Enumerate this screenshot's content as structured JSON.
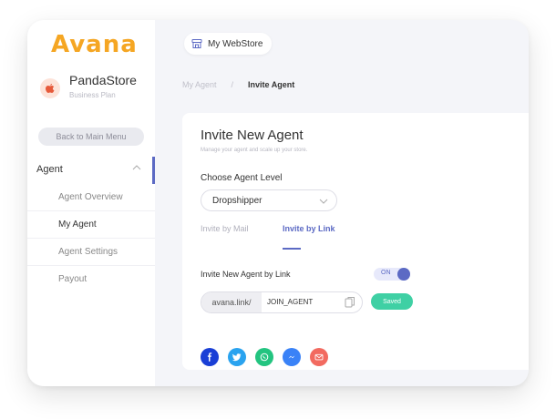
{
  "brand": {
    "logo": "Avana"
  },
  "store": {
    "avatar_icon": "apple-icon",
    "name": "PandaStore",
    "plan": "Business Plan"
  },
  "sidebar": {
    "back_label": "Back to Main Menu",
    "section": {
      "label": "Agent",
      "expanded": true
    },
    "items": [
      {
        "label": "Agent Overview",
        "active": false
      },
      {
        "label": "My Agent",
        "active": true
      },
      {
        "label": "Agent Settings",
        "active": false
      },
      {
        "label": "Payout",
        "active": false
      }
    ]
  },
  "topbar": {
    "store_button": "My WebStore",
    "store_icon": "store-icon"
  },
  "breadcrumb": {
    "parent": "My Agent",
    "separator": "/",
    "current": "Invite Agent"
  },
  "card": {
    "title": "Invite New Agent",
    "subtitle": "Manage your agent and scale up your store.",
    "level_label": "Choose Agent Level",
    "level_value": "Dropshipper",
    "tabs": [
      {
        "label": "Invite by Mail",
        "active": false
      },
      {
        "label": "Invite by Link",
        "active": true
      }
    ],
    "link_label": "Invite New Agent by Link",
    "toggle_label": "ON",
    "toggle_on": true,
    "link_prefix": "avana.link/",
    "link_value": "JOIN_AGENT",
    "saved_label": "Saved",
    "share": [
      {
        "name": "facebook-icon",
        "glyph": "f",
        "color": "#1a3fd6"
      },
      {
        "name": "twitter-icon",
        "glyph": "t",
        "color": "#2aa3ef"
      },
      {
        "name": "whatsapp-icon",
        "glyph": "w",
        "color": "#23c480"
      },
      {
        "name": "messenger-icon",
        "glyph": "m",
        "color": "#3a82f7"
      },
      {
        "name": "mail-icon",
        "glyph": "✉",
        "color": "#f26a60"
      }
    ]
  },
  "colors": {
    "accent": "#5c6ac4",
    "brand": "#f5a623",
    "success": "#3fd0a4"
  }
}
